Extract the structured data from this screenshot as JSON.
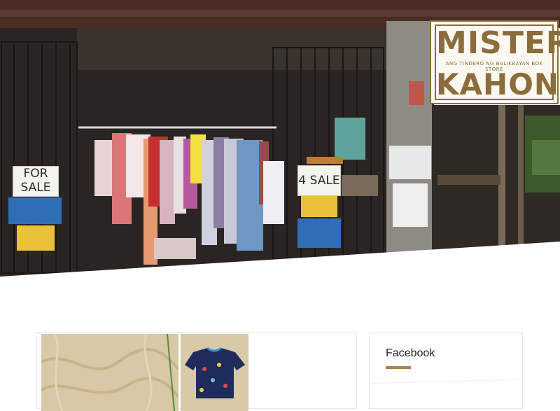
{
  "brand": {
    "name_top": "MISTER",
    "name_bottom": "KAHON",
    "tagline": "ANG TINDERO NG BALIKBAYAN BOX STORE",
    "color": "#8a6d3b"
  },
  "hero": {
    "signs": {
      "for_sale": "FOR SALE",
      "for_sale_2": "4 SALE"
    }
  },
  "sidebar": {
    "widget_title": "Facebook",
    "accent": "#a6864a"
  },
  "post": {
    "thumbnail_count": 2
  }
}
